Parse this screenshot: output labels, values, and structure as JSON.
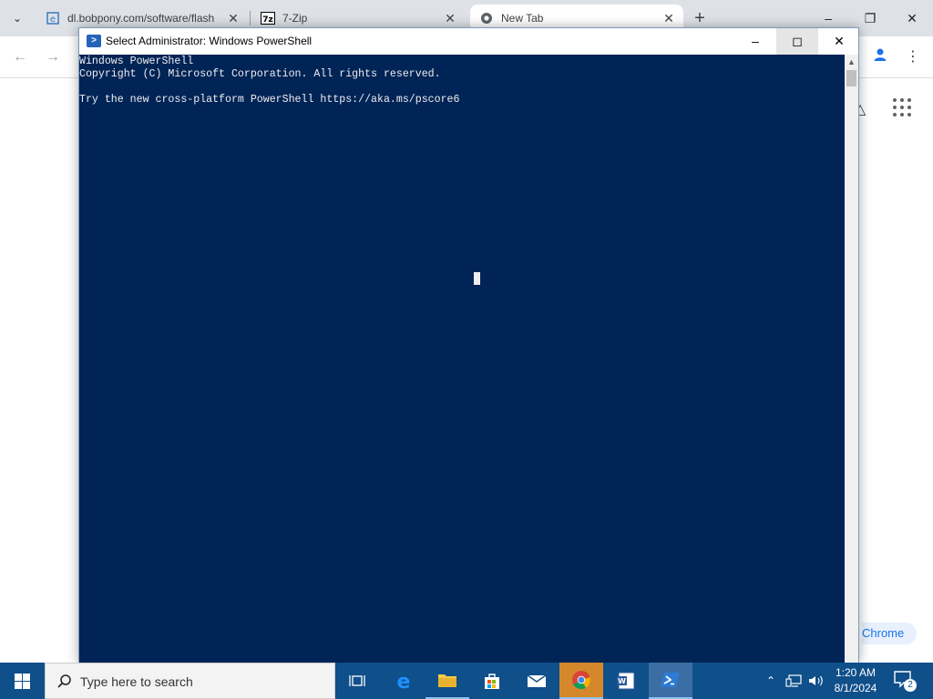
{
  "chrome": {
    "tabs": [
      {
        "title": "dl.bobpony.com/software/flash",
        "icon": "ie-page-icon"
      },
      {
        "title": "7-Zip",
        "icon": "7zip-icon"
      },
      {
        "title": "New Tab",
        "icon": "chrome-icon"
      }
    ],
    "customize_label": "Chrome"
  },
  "powershell": {
    "title": "Select Administrator: Windows PowerShell",
    "lines": [
      "Windows PowerShell",
      "Copyright (C) Microsoft Corporation. All rights reserved.",
      "",
      "Try the new cross-platform PowerShell https://aka.ms/pscore6"
    ],
    "background_color": "#012456",
    "text_color": "#EEEDF0"
  },
  "taskbar": {
    "search_placeholder": "Type here to search",
    "apps": [
      {
        "name": "task-view-icon"
      },
      {
        "name": "edge-icon"
      },
      {
        "name": "file-explorer-icon"
      },
      {
        "name": "store-icon"
      },
      {
        "name": "mail-icon"
      },
      {
        "name": "chrome-icon",
        "state": "running"
      },
      {
        "name": "wordpad-icon"
      },
      {
        "name": "powershell-icon",
        "state": "active"
      }
    ],
    "clock": {
      "time": "1:20 AM",
      "date": "8/1/2024"
    },
    "notification_count": "2"
  }
}
